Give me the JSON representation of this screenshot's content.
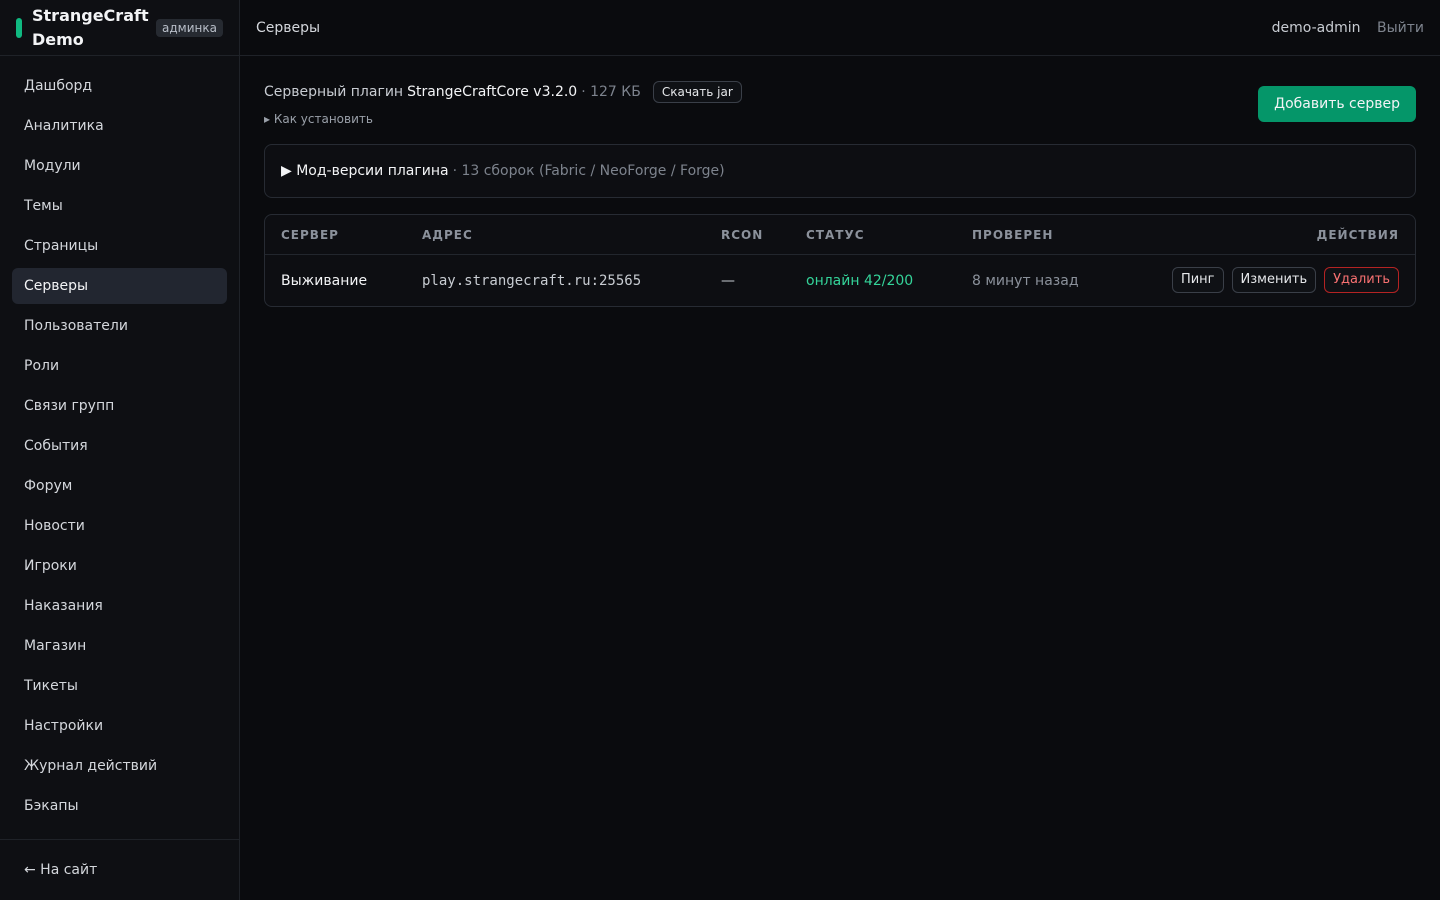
{
  "brand": {
    "name": "StrangeCraft Demo",
    "badge": "админка",
    "accent": "#10b981"
  },
  "nav": {
    "items": [
      {
        "label": "Дашборд"
      },
      {
        "label": "Аналитика"
      },
      {
        "label": "Модули"
      },
      {
        "label": "Темы"
      },
      {
        "label": "Страницы"
      },
      {
        "label": "Серверы",
        "active": true
      },
      {
        "label": "Пользователи"
      },
      {
        "label": "Роли"
      },
      {
        "label": "Связи групп"
      },
      {
        "label": "События"
      },
      {
        "label": "Форум"
      },
      {
        "label": "Новости"
      },
      {
        "label": "Игроки"
      },
      {
        "label": "Наказания"
      },
      {
        "label": "Магазин"
      },
      {
        "label": "Тикеты"
      },
      {
        "label": "Настройки"
      },
      {
        "label": "Журнал действий"
      },
      {
        "label": "Бэкапы"
      }
    ],
    "back_link": "← На сайт"
  },
  "topbar": {
    "title": "Серверы",
    "user": "demo-admin",
    "logout": "Выйти"
  },
  "plugin": {
    "label": "Серверный плагин",
    "name": "StrangeCraftCore v3.2.0",
    "size": "· 127 КБ",
    "download": "Скачать jar",
    "howto": "▸ Как установить"
  },
  "add_server": "Добавить сервер",
  "mods": {
    "title": "▶ Мод-версии плагина",
    "meta": "· 13 сборок (Fabric / NeoForge / Forge)"
  },
  "table": {
    "headers": {
      "server": "СЕРВЕР",
      "address": "АДРЕС",
      "rcon": "RCON",
      "status": "СТАТУС",
      "checked": "ПРОВЕРЕН",
      "actions": "ДЕЙСТВИЯ"
    },
    "rows": [
      {
        "server": "Выживание",
        "address": "play.strangecraft.ru:25565",
        "rcon": "—",
        "status": "онлайн 42/200",
        "checked": "8 минут назад",
        "actions": {
          "ping": "Пинг",
          "edit": "Изменить",
          "delete": "Удалить"
        }
      }
    ]
  },
  "colors": {
    "primary": "#059669",
    "online": "#34d399",
    "danger": "#f87171"
  }
}
